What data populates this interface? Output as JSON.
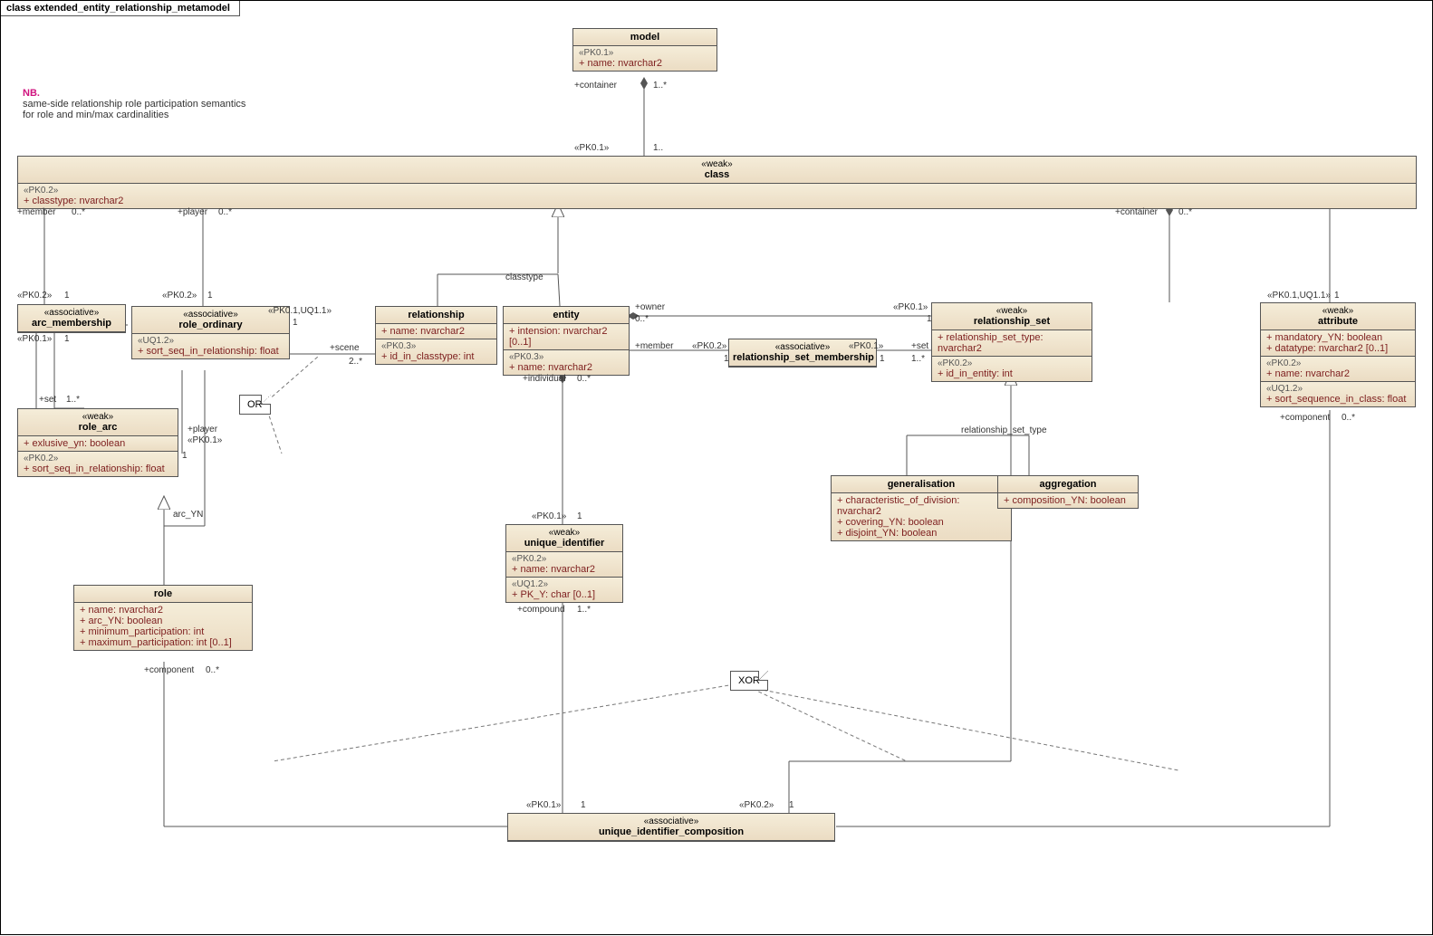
{
  "frame_title": "class extended_entity_relationship_metamodel",
  "note": {
    "nb": "NB.",
    "l1": "same-side relationship role participation semantics",
    "l2": "for role and min/max cardinalities"
  },
  "model": {
    "st": "",
    "nm": "model",
    "k1": "«PK0.1»",
    "a1": "+   name:  nvarchar2"
  },
  "class": {
    "st": "«weak»",
    "nm": "class",
    "k1": "«PK0.2»",
    "a1": "+   classtype:  nvarchar2"
  },
  "arc_membership": {
    "st": "«associative»",
    "nm": "arc_membership"
  },
  "role_ordinary": {
    "st": "«associative»",
    "nm": "role_ordinary",
    "k1": "«UQ1.2»",
    "a1": "+   sort_seq_in_relationship:  float"
  },
  "relationship": {
    "nm": "relationship",
    "a1": "+   name:  nvarchar2",
    "k2": "«PK0.3»",
    "a2": "+   id_in_classtype:  int"
  },
  "entity": {
    "nm": "entity",
    "a1": "+   intension:  nvarchar2 [0..1]",
    "k2": "«PK0.3»",
    "a2": "+   name:  nvarchar2"
  },
  "rs_membership": {
    "st": "«associative»",
    "nm": "relationship_set_membership"
  },
  "relationship_set": {
    "st": "«weak»",
    "nm": "relationship_set",
    "a1": "+   relationship_set_type:  nvarchar2",
    "k2": "«PK0.2»",
    "a2": "+   id_in_entity:  int"
  },
  "attribute": {
    "st": "«weak»",
    "nm": "attribute",
    "a1": "+   mandatory_YN:  boolean",
    "a2": "+   datatype:  nvarchar2 [0..1]",
    "k2": "«PK0.2»",
    "a3": "+   name:  nvarchar2",
    "k3": "«UQ1.2»",
    "a4": "+   sort_sequence_in_class:  float"
  },
  "role_arc": {
    "st": "«weak»",
    "nm": "role_arc",
    "a1": "+   exlusive_yn:  boolean",
    "k2": "«PK0.2»",
    "a2": "+   sort_seq_in_relationship:  float"
  },
  "role": {
    "nm": "role",
    "a1": "+   name:  nvarchar2",
    "a2": "+   arc_YN:  boolean",
    "a3": "+   minimum_participation:  int",
    "a4": "+   maximum_participation:  int [0..1]"
  },
  "unique_identifier": {
    "st": "«weak»",
    "nm": "unique_identifier",
    "k1": "«PK0.2»",
    "a1": "+   name:  nvarchar2",
    "k2": "«UQ1.2»",
    "a2": "+   PK_Y:  char [0..1]"
  },
  "generalisation": {
    "nm": "generalisation",
    "a1": "+   characteristic_of_division:  nvarchar2",
    "a2": "+   covering_YN:  boolean",
    "a3": "+   disjoint_YN:  boolean"
  },
  "aggregation": {
    "nm": "aggregation",
    "a1": "+   composition_YN:  boolean"
  },
  "uic": {
    "st": "«associative»",
    "nm": "unique_identifier_composition"
  },
  "or_note": "OR",
  "xor_note": "XOR",
  "lbls": {
    "container": "+container",
    "member": "+member",
    "player": "+player",
    "owner": "+owner",
    "set": "+set",
    "individual": "+individual",
    "compound": "+compound",
    "component": "+component",
    "scene": "+scene",
    "pk01": "«PK0.1»",
    "pk02": "«PK0.2»",
    "pk01uq11": "«PK0.1,UQ1.1»",
    "m1": "1",
    "m1s": "1..*",
    "m1d": "1..",
    "m0s": "0..*",
    "m2s": "2..*",
    "classtype": "classtype",
    "arc_YN": "arc_YN",
    "rstype": "relationship_set_type"
  }
}
